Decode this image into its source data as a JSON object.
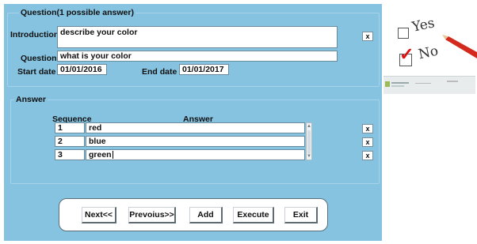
{
  "question_group": {
    "title": "Question(1 possible answer)",
    "introduction_label": "Introduction",
    "introduction_value": "describe your color",
    "question_label": "Question",
    "question_value": "what is your color",
    "start_date_label": "Start date",
    "start_date_value": "01/01/2016",
    "end_date_label": "End date",
    "end_date_value": "01/01/2017",
    "clear_label": "x"
  },
  "answer_group": {
    "title": "Answer",
    "col_sequence": "Sequence",
    "col_answer": "Answer",
    "rows": [
      {
        "sequence": "1",
        "answer": "red",
        "delete": "x"
      },
      {
        "sequence": "2",
        "answer": "blue",
        "delete": "x"
      },
      {
        "sequence": "3",
        "answer": "green",
        "delete": "x"
      }
    ]
  },
  "buttons": {
    "next": "Next<<",
    "previous": "Prevoius>>",
    "add": "Add",
    "execute": "Execute",
    "exit": "Exit"
  },
  "illustration": {
    "yes": "Yes",
    "no": "No",
    "check_color": "#d11111"
  },
  "colors": {
    "panel": "#86c3e0"
  }
}
